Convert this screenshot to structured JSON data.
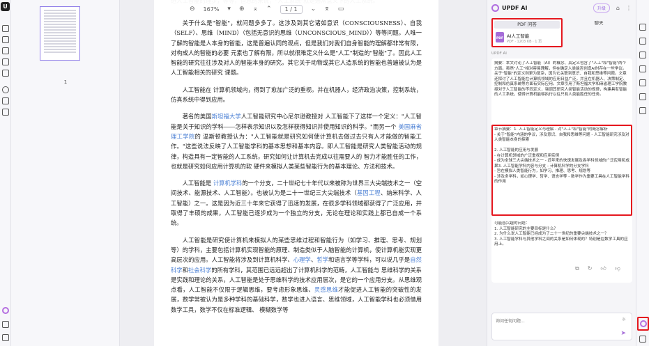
{
  "toolbar": {
    "zoom": "167%",
    "page_current": "1 / 1"
  },
  "thumbnails": {
    "page_number": "1"
  },
  "document": {
    "top_line": "进人工智能的理步，等等，但总的来说，\"人工系统\"就是通常意义下的人工系统。",
    "paragraphs": [
      [
        "关于什么是\"智能\"，就问题多多了。这涉及到其它诸如意识（CONSCIOUSNESS）、自我（SELF）、思维（MIND）（包括无意识的思维（UNCONSCIOUS_MIND））等等问题。人唯一了解的智能是人本身的智能，这是普遍认同的观点，但是我们对我们自身智能的理解都非常有限，对构成人的智能的必要 元素也了解有限，所以就很难定义什么是\"人工\"制造的\"智能\"了。因此人工智能的研究往往涉及对人的智能本身的研究。其它关于动物或其它人造系统的智能也普遍被认为是人工智能相关的研究 课题。"
      ],
      [
        "人工智能在 计算机领域内，得到了愈加广泛的重视。并在机器人，经济政治决策，控制系统，仿真系统中得到应用。"
      ],
      [
        "著名的美国",
        "斯坦福大学",
        "人工智能研究中心尼尔逊教授对 人工智能下了这样一个定义：\"人工智能是关于知识的学科――怎样表示知识以及怎样获得知识并使用知识的科学。\"而另一个 ",
        "美国麻省理工学院",
        "的 温斯顿教授认为：\"人工智能就是研究如何使计算机去做过去只有人才能做的智能工作。\"这些说法反映了人工智能学科的基本思想和基本内容。即人工智能是研究人类智能活动的规律，构造具有一定智能的人工系统，研究如何让计算机去完成以往需要人的 智力才能胜任的工作，也就是研究如何应用计算机的软 硬件来模拟人类某些智能行为的基本理论、方法和技术。"
      ],
      [
        "人工智能是 ",
        "计算机学科",
        "的一个分支，二十世纪七十年代以来被称为世界三大尖端技术之一（空间技术、能源技术、人工智能）。也被认为是二十一世纪三大尖端技术（",
        "基因工程",
        "、纳米科学、人工智能）之一。这是因为近三十年来它获得了迅速的发展，在很多学科领域都获得了广泛应用，并取得了丰硕的成果，人工智能已逐步成为一个独立的分支，无论在理论和实践上都已自成一个系统。"
      ],
      [
        "人工智能是研究使计算机来模拟人的某些思维过程和智能行为（如学习、推理、思考、规划等）的学科，主要包括计算机实现智能的原理、制造类似于人脑智能的计算机，使计算机能实现更高层次的应用。人工智能将涉及到计算机科学、",
        "心理学",
        "、",
        "哲学",
        "和语言学等学科，可以说几乎是",
        "自然科学",
        "和",
        "社会科学",
        "的所有学科，其范围已远远超出了计算机科学的范畴，人工智能与 思维科学的关系是实践和理论的关系，人工智能是处于思维科学的技术应用层次，是它的一个应用分支。从思维观点看，人工智能不仅限于逻辑思维，要考虑形象思维、",
        "灵感思维",
        "才能促进人工智能的突破性的发展，数学常被认为是多种学科的基础科学，数学也进入语言、思维领域，人工智能学科也必须借用数学工具，数学不仅在标准逻辑、 模糊数学等"
      ]
    ]
  },
  "ai_panel": {
    "title": "UPDF AI",
    "upgrade": "升级",
    "tab_pdf": "PDF 问答",
    "tab_chat": "聊天",
    "file_name": "AI人工智能",
    "file_meta": "PDF · 1203 KB · 1 页",
    "file_badge": "PDF",
    "label": "UPDF AI",
    "summary": "摘要：本文讨论了人工智能（AI）的概念、其定义包含了\"人工\"和\"智能\"两个方面。虽然\"人工\"相对容易理解，但在确定人类能否创造AI时存在一些争议。关于\"智能\"的定义则更为复杂，因为它关联到意识、自我和思维等问题。文章还探讨了人工智能在计算机领域的应用日益广泛，并且在机器人、决策制定、控制和仿真系统等方面有实际应用。文章引用了斯坦福大学和麻省理工学院教授对于人工智能的不同定义，强调其研究人类智能活动的规律，构建具有智能的人工系统，使得计算机能够执行以往只有人类能胜任的任务。",
    "chapter": "章节摘要：1. 人工智能定义与理解 - 对\"人工\"和\"智能\"的概念解析\n - 关于\"智能\"内涵的争议，涉及意识、自我和思维等问题 - 人工智能研究涉及对人类智能本身的探索\n\n2. 人工智能的应用与发展\n - 在计算机领域的广泛重视和应用实例\n - 成为全球三大尖端技术之一 - 近年来的快速发展及各学科领域的广泛应用和成果3. 人工智能学科内容与分支 - 计算机科学的分支学科\n - 旨在模拟人类智能行为，如学习、推理、思考、规划等\n - 涉及多学科，如心理学、哲学、语言学等 - 数学作为重要工具在人工智能学科的作用",
    "questions": "可能感兴趣的问题：\n1. 人工智能研究的主要目标是什么？\n2. 为什么说人工智能已经成为了二十一世纪的重要尖端技术之一？\n3. 人工智能学科与其他学科之间的关系是如何体现的？特别是在数学工具的应用上。",
    "ask_placeholder": "询问任何问题..."
  },
  "colors": {
    "accent": "#a56cd8",
    "highlight_box": "#e5171e",
    "link": "#4a7fd4"
  }
}
